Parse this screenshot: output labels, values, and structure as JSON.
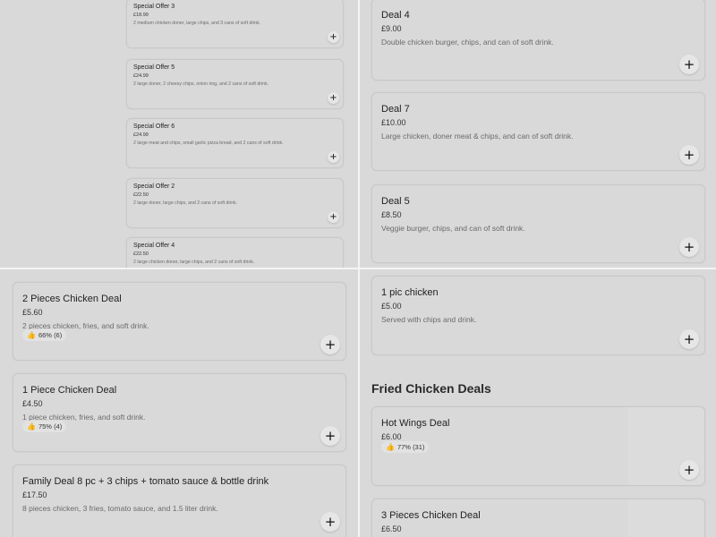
{
  "top_left": {
    "offers": [
      {
        "title": "Special Offer 3",
        "price": "£18.99",
        "desc": "2 medium chicken doner, large chips, and 3 cans of soft drink.",
        "add": "+"
      },
      {
        "title": "Special Offer 5",
        "price": "£24.99",
        "desc": "2 large doner, 2 cheesy chips, onion ring, and 2 cans of soft drink.",
        "add": "+"
      },
      {
        "title": "Special Offer 6",
        "price": "£24.99",
        "desc": "2 large meat and chips, small garlic pizza bread, and 2 cans of soft drink.",
        "add": "+"
      },
      {
        "title": "Special Offer 2",
        "price": "£22.50",
        "desc": "2 large doner, large chips, and 2 cans of soft drink.",
        "add": "+"
      },
      {
        "title": "Special Offer 4",
        "price": "£22.50",
        "desc": "2 large chicken doner, large chips, and 2 cans of soft drink.",
        "add": "+"
      }
    ]
  },
  "top_right": {
    "deals": [
      {
        "title": "Deal 4",
        "price": "£9.00",
        "desc": "Double chicken burger, chips, and can of soft drink.",
        "add": "+"
      },
      {
        "title": "Deal 7",
        "price": "£10.00",
        "desc": "Large chicken, doner meat & chips, and can of soft drink.",
        "add": "+"
      },
      {
        "title": "Deal 5",
        "price": "£8.50",
        "desc": "Veggie burger, chips, and can of soft drink.",
        "add": "+"
      }
    ]
  },
  "bottom_left": {
    "deals": [
      {
        "title": "2 Pieces Chicken Deal",
        "price": "£5.60",
        "desc": "2 pieces chicken, fries, and soft drink.",
        "rating": "66% (6)",
        "add": "+"
      },
      {
        "title": "1 Piece Chicken Deal",
        "price": "£4.50",
        "desc": "1 piece chicken, fries, and soft drink.",
        "rating": "75% (4)",
        "add": "+"
      },
      {
        "title": "Family Deal 8 pc + 3 chips + tomato sauce & bottle drink",
        "price": "£17.50",
        "desc": "8 pieces chicken, 3 fries, tomato sauce, and 1.5 liter drink.",
        "add": "+"
      }
    ]
  },
  "bottom_right": {
    "item": {
      "title": "1 pic chicken",
      "price": "£5.00",
      "desc": "Served with chips and drink.",
      "add": "+"
    },
    "section_title": "Fried Chicken Deals",
    "section_items": [
      {
        "title": "Hot Wings Deal",
        "price": "£6.00",
        "rating": "77% (31)",
        "add": "+"
      },
      {
        "title": "3 Pieces Chicken Deal",
        "price": "£6.50"
      }
    ]
  },
  "icons": {
    "add": "plus-icon",
    "rating": "thumbs-up-icon"
  },
  "colors": {
    "overlay": "#d9d9d9",
    "divider": "#f4f4f4"
  }
}
